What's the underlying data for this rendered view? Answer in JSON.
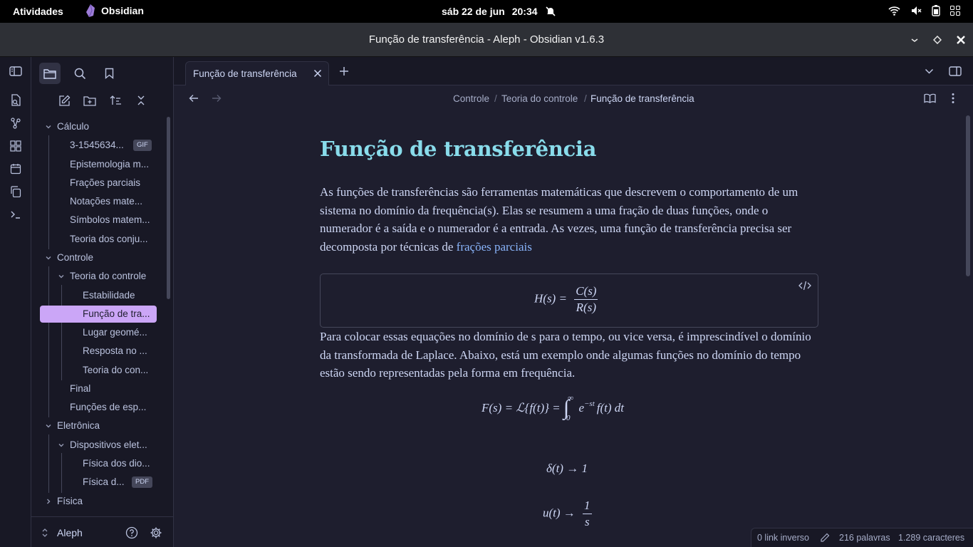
{
  "topbar": {
    "activities": "Atividades",
    "app_name": "Obsidian",
    "date": "sáb 22 de jun",
    "time": "20:34"
  },
  "window": {
    "title": "Função de transferência - Aleph - Obsidian v1.6.3"
  },
  "sidebar": {
    "tree": [
      {
        "label": "Cálculo",
        "type": "folder"
      },
      {
        "label": "3-1545634...",
        "badge": "GIF"
      },
      {
        "label": "Epistemologia m..."
      },
      {
        "label": "Frações parciais"
      },
      {
        "label": "Notações mate..."
      },
      {
        "label": "Símbolos matem..."
      },
      {
        "label": "Teoria dos conju..."
      },
      {
        "label": "Controle",
        "type": "folder"
      },
      {
        "label": "Teoria do controle",
        "type": "folder"
      },
      {
        "label": "Estabilidade"
      },
      {
        "label": "Função de tra...",
        "active": true
      },
      {
        "label": "Lugar geomé..."
      },
      {
        "label": "Resposta no ..."
      },
      {
        "label": "Teoria do con..."
      },
      {
        "label": "Final"
      },
      {
        "label": "Funções de esp..."
      },
      {
        "label": "Eletrônica",
        "type": "folder"
      },
      {
        "label": "Dispositivos elet...",
        "type": "folder"
      },
      {
        "label": "Física dos dio..."
      },
      {
        "label": "Física d...",
        "badge": "PDF"
      },
      {
        "label": "Física",
        "type": "folder",
        "collapsed": true
      }
    ],
    "vault_name": "Aleph"
  },
  "tab": {
    "label": "Função de transferência"
  },
  "breadcrumb": [
    "Controle",
    "/",
    "Teoria do controle",
    "/",
    "Função de transferência"
  ],
  "note": {
    "title": "Função de transferência",
    "p1_text": "As funções de transferências são ferramentas matemáticas que descrevem o comportamento de um sistema no domínio da frequência(s). Elas se resumem a uma fração de duas funções, onde o numerador é a saída e o numerador é a entrada. As vezes, uma função de transferência precisa ser decomposta por técnicas de ",
    "p1_link": "frações parciais",
    "eq1_lhs": "H(s) =",
    "eq1_num": "C(s)",
    "eq1_den": "R(s)",
    "p2_text": "Para colocar essas equações no domínio de s para o tempo, ou vice versa, é imprescindível o domínio da transformada de Laplace. Abaixo, está um exemplo onde algumas funções no domínio do tempo estão sendo representadas pela forma em frequência.",
    "eq2": "F(s) = ℒ{f(t)} = ",
    "eq2_int_upper": "∞",
    "eq2_int_lower": "0",
    "eq2_rest": "e",
    "eq2_exp": "−st",
    "eq2_tail": "f(t) dt",
    "eq3": "δ(t) → 1",
    "eq4_lhs": "u(t) →",
    "eq4_num": "1",
    "eq4_den": "s"
  },
  "status": {
    "backlinks": "0 link inverso",
    "words": "216 palavras",
    "chars": "1.289 caracteres"
  },
  "colors": {
    "accent": "#cba6f7",
    "heading": "#89dceb",
    "link": "#89b4fa",
    "background": "#1e1e2e"
  }
}
